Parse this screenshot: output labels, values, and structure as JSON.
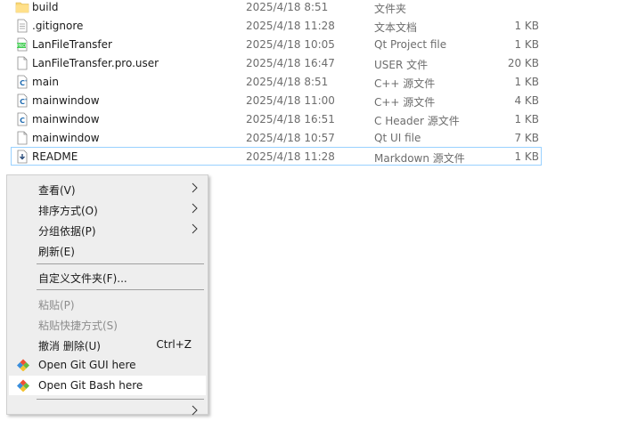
{
  "files": [
    {
      "name": "build",
      "date": "2025/4/18 8:51",
      "type": "文件夹",
      "size": "",
      "icon": "folder-icon"
    },
    {
      "name": ".gitignore",
      "date": "2025/4/18 11:28",
      "type": "文本文档",
      "size": "1 KB",
      "icon": "text-file-icon"
    },
    {
      "name": "LanFileTransfer",
      "date": "2025/4/18 10:05",
      "type": "Qt Project file",
      "size": "1 KB",
      "icon": "qt-project-icon"
    },
    {
      "name": "LanFileTransfer.pro.user",
      "date": "2025/4/18 16:47",
      "type": "USER 文件",
      "size": "20 KB",
      "icon": "blank-file-icon"
    },
    {
      "name": "main",
      "date": "2025/4/18 8:51",
      "type": "C++ 源文件",
      "size": "1 KB",
      "icon": "cpp-file-icon"
    },
    {
      "name": "mainwindow",
      "date": "2025/4/18 11:00",
      "type": "C++ 源文件",
      "size": "4 KB",
      "icon": "cpp-file-icon"
    },
    {
      "name": "mainwindow",
      "date": "2025/4/18 16:51",
      "type": "C Header 源文件",
      "size": "1 KB",
      "icon": "c-header-icon"
    },
    {
      "name": "mainwindow",
      "date": "2025/4/18 10:57",
      "type": "Qt UI file",
      "size": "7 KB",
      "icon": "qt-ui-file-icon"
    },
    {
      "name": "README",
      "date": "2025/4/18 11:28",
      "type": "Markdown 源文件",
      "size": "1 KB",
      "icon": "markdown-file-icon"
    }
  ],
  "context_menu": {
    "view": "查看(V)",
    "sort_by": "排序方式(O)",
    "group_by": "分组依据(P)",
    "refresh": "刷新(E)",
    "customize_folder": "自定义文件夹(F)...",
    "paste": "粘贴(P)",
    "paste_shortcut": "粘贴快捷方式(S)",
    "undo_delete": "撤消 删除(U)",
    "undo_shortcut": "Ctrl+Z",
    "open_git_gui": "Open Git GUI here",
    "open_git_bash": "Open Git Bash here"
  },
  "colors": {
    "selection_border": "#99d1ff",
    "menu_background": "#eeeeee",
    "git_icon_top": "#f05033",
    "git_icon_left": "#3a8edb",
    "git_icon_right": "#67b93e",
    "git_icon_bottom": "#f4c32f"
  }
}
